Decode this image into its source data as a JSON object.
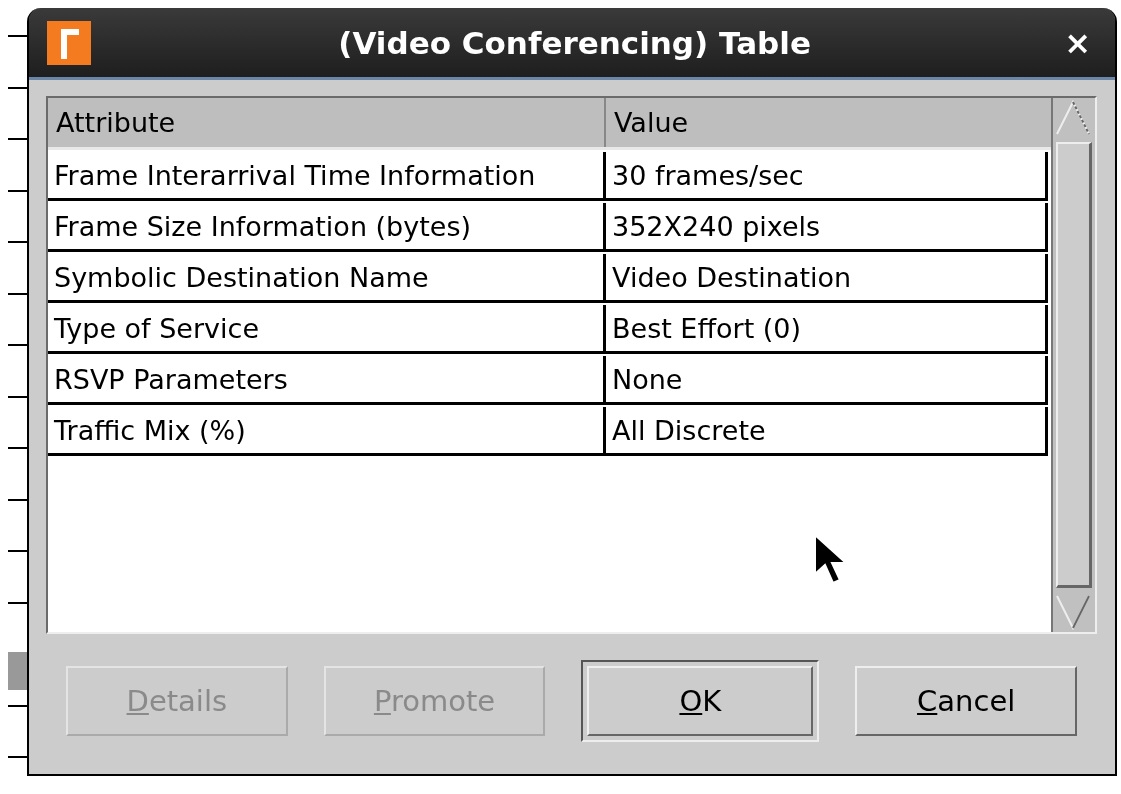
{
  "window": {
    "title": "(Video Conferencing) Table",
    "close": "×"
  },
  "table": {
    "columns": [
      "Attribute",
      "Value"
    ],
    "rows": [
      {
        "attribute": "Frame Interarrival Time Information",
        "value": "30 frames/sec"
      },
      {
        "attribute": "Frame Size Information (bytes)",
        "value": "352X240 pixels"
      },
      {
        "attribute": "Symbolic Destination Name",
        "value": "Video Destination"
      },
      {
        "attribute": "Type of Service",
        "value": "Best Effort (0)"
      },
      {
        "attribute": "RSVP Parameters",
        "value": "None"
      },
      {
        "attribute": "Traffic Mix (%)",
        "value": "All Discrete"
      }
    ]
  },
  "buttons": [
    {
      "label": "Details",
      "disabled": true,
      "default": false
    },
    {
      "label": "Promote",
      "disabled": true,
      "default": false
    },
    {
      "label": "OK",
      "disabled": false,
      "default": true
    },
    {
      "label": "Cancel",
      "disabled": false,
      "default": false
    }
  ]
}
